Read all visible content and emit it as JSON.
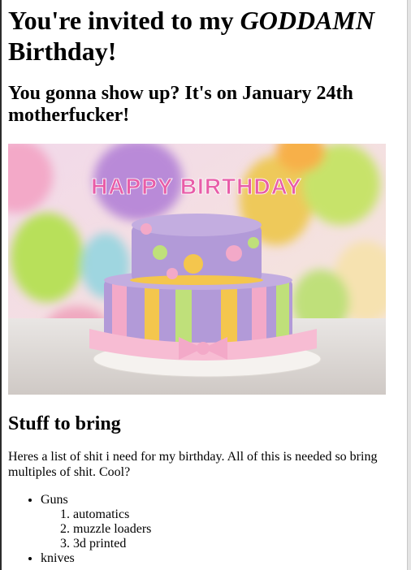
{
  "page": {
    "title_prefix": "You're invited to my ",
    "title_emphasis": "GODDAMN",
    "title_suffix": " Birthday!",
    "subtitle": "You gonna show up? It's on January 24th motherfucker!"
  },
  "image": {
    "cake_topper": "HAPPY BIRTHDAY",
    "colors": {
      "balloon_purple": "#b98ad8",
      "balloon_green": "#b8e05a",
      "balloon_orange": "#f7b04a",
      "cake_purple": "#b29ad8",
      "cake_pink": "#f3a9c8",
      "cake_yellow": "#f4c64d",
      "cake_green": "#bfe07a"
    }
  },
  "section": {
    "heading": "Stuff to bring",
    "intro": "Heres a list of shit i need for my birthday. All of this is needed so bring multiples of shit. Cool?"
  },
  "list": [
    {
      "label": "Guns",
      "sub": [
        "automatics",
        "muzzle loaders",
        "3d printed"
      ]
    },
    {
      "label": "knives",
      "sub": []
    }
  ]
}
